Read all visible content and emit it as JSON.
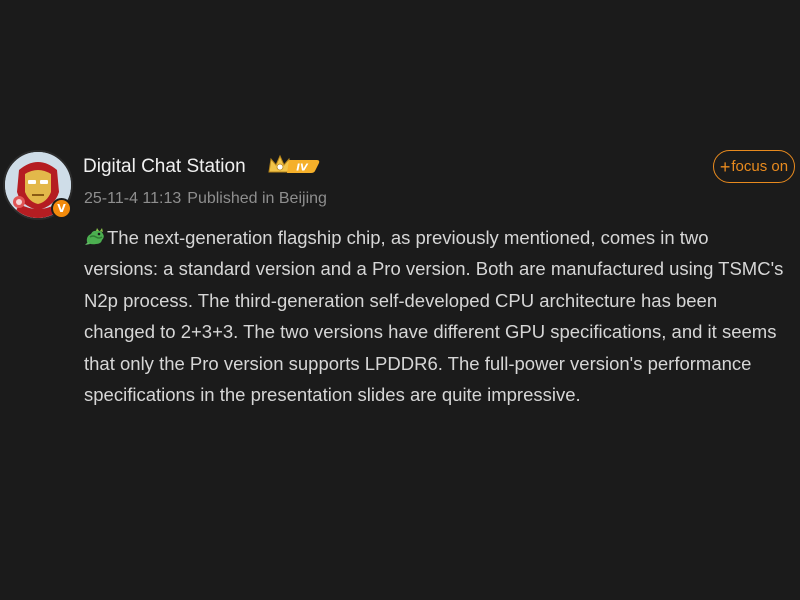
{
  "post": {
    "author": {
      "name": "Digital Chat Station",
      "level_badge": "IV",
      "verified_mark": "V",
      "avatar_icon": "iron-man-avatar-icon",
      "accent": "#f28a0c"
    },
    "date": "25-11-4 11:13",
    "location": "Published in Beijing",
    "follow_label": "focus on",
    "follow_prefix": "+",
    "emoji_icon": "dragon-emoji-icon",
    "text": "The next-generation flagship chip, as previously mentioned, comes in two versions: a standard version and a Pro version. Both are manufactured using TSMC's N2p process. The third-generation self-developed CPU architecture has been changed to 2+3+3. The two versions have different GPU specifications, and it seems that only the Pro version supports LPDDR6. The full-power version's performance specifications in the presentation slides are quite impressive."
  },
  "colors": {
    "background": "#1b1b1b",
    "text": "#d6d6d6",
    "muted": "#8e8e8e",
    "follow": "#e88a1e"
  }
}
